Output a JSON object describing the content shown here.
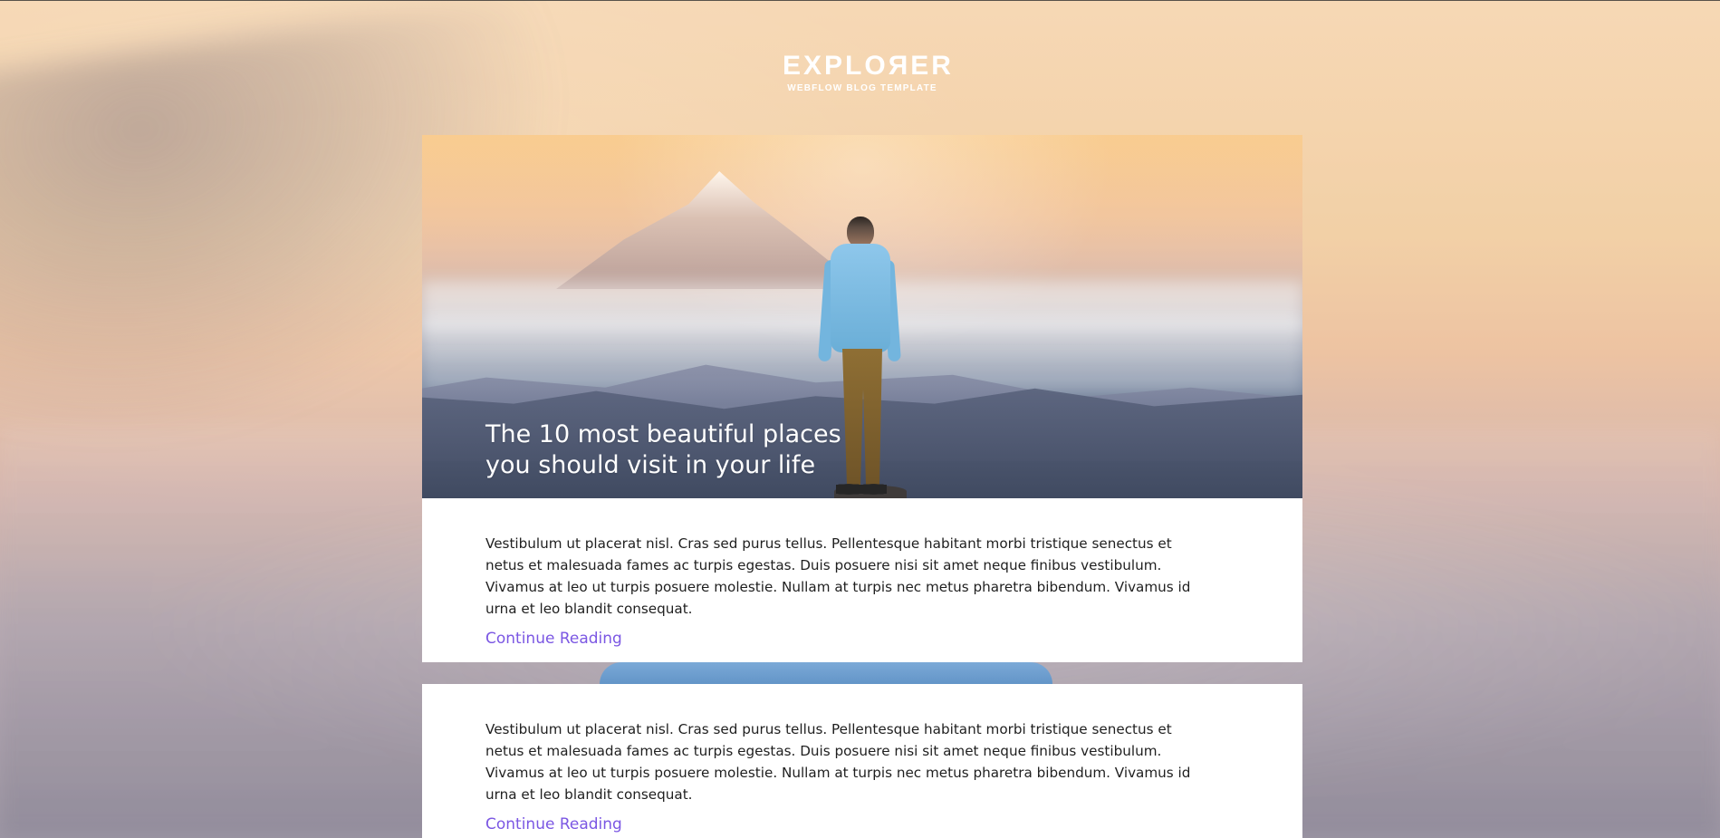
{
  "site": {
    "brand_title": "EXPLOЯER",
    "brand_subtitle": "WEBFLOW BLOG TEMPLATE"
  },
  "posts": [
    {
      "title": "The 10 most beautiful places you should visit in your life",
      "excerpt": "Vestibulum ut placerat nisl. Cras sed purus tellus. Pellentesque habitant morbi tristique senectus et netus et malesuada fames ac turpis egestas. Duis posuere nisi sit amet neque finibus vestibulum. Vivamus at leo ut turpis posuere molestie. Nullam at turpis nec metus pharetra bibendum. Vivamus id urna et leo blandit consequat.",
      "cta": "Continue Reading"
    },
    {
      "excerpt": "Vestibulum ut placerat nisl. Cras sed purus tellus. Pellentesque habitant morbi tristique senectus et netus et malesuada fames ac turpis egestas. Duis posuere nisi sit amet neque finibus vestibulum. Vivamus at leo ut turpis posuere molestie. Nullam at turpis nec metus pharetra bibendum. Vivamus id urna et leo blandit consequat.",
      "cta": "Continue Reading"
    }
  ],
  "colors": {
    "link": "#7b57e3",
    "text": "#1f1f1f"
  }
}
